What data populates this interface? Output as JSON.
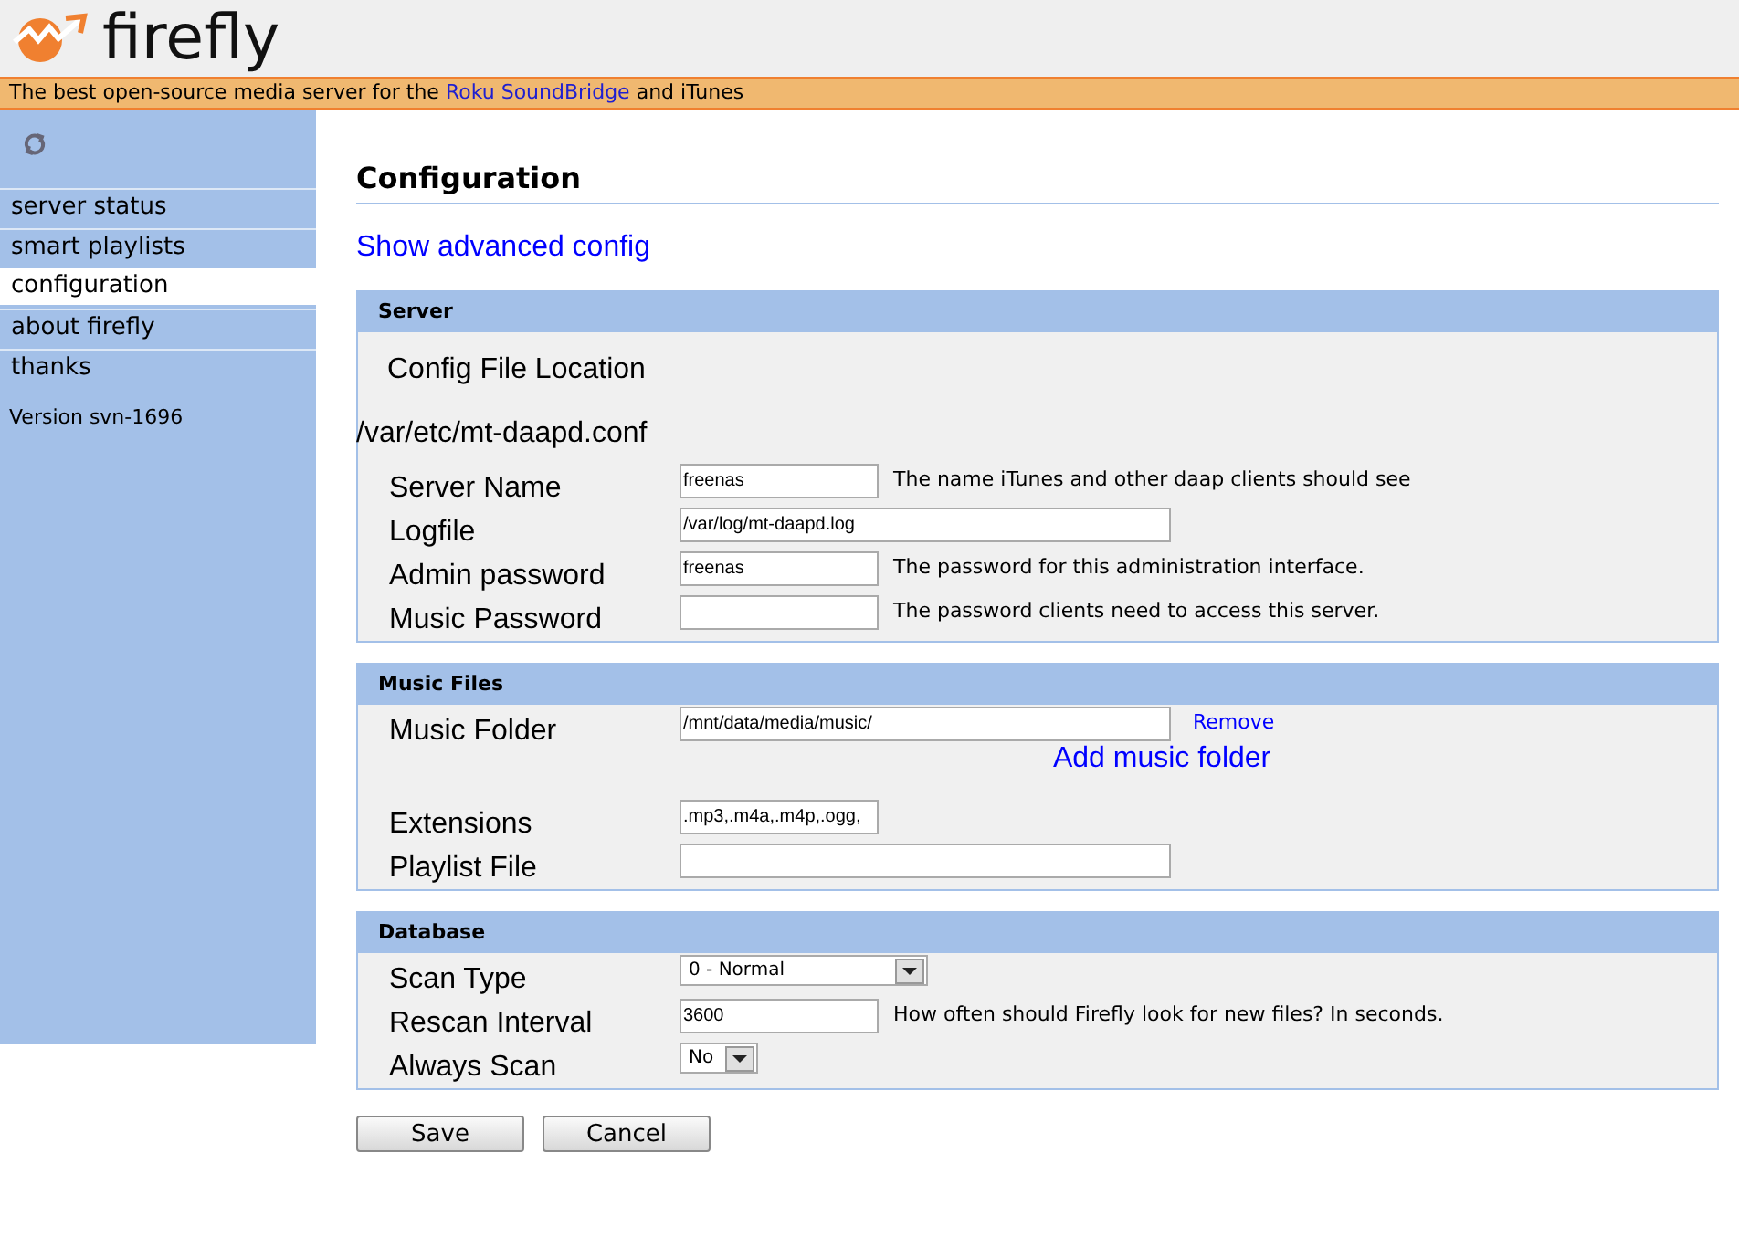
{
  "logo": {
    "text": "firefly"
  },
  "tagline": {
    "before": "The best open-source media server for the",
    "link": "Roku SoundBridge",
    "after": "and iTunes"
  },
  "sidebar": {
    "items": [
      {
        "label": "server status",
        "selected": false
      },
      {
        "label": "smart playlists",
        "selected": false
      },
      {
        "label": "configuration",
        "selected": true
      },
      {
        "label": "about firefly",
        "selected": false
      },
      {
        "label": "thanks",
        "selected": false
      }
    ],
    "version": "Version svn-1696"
  },
  "page_title": "Configuration",
  "advanced_link": "Show advanced config",
  "sections": [
    {
      "title": "Server",
      "config_label": "Config File Location",
      "config_path": "/var/etc/mt-daapd.conf",
      "rows": [
        {
          "kind": "input",
          "label": "Server Name",
          "value": "freenas",
          "hint": "The name iTunes and other daap clients should see"
        },
        {
          "kind": "wide_input",
          "label": "Logfile",
          "value": "/var/log/mt-daapd.log"
        },
        {
          "kind": "input",
          "label": "Admin password",
          "value": "freenas",
          "hint": "The password for this administration interface."
        },
        {
          "kind": "input",
          "label": "Music Password",
          "hint": "The password clients need to access this server."
        }
      ]
    },
    {
      "title": "Music Files",
      "rows": [
        {
          "kind": "folder",
          "label": "Music Folder",
          "value": "/mnt/data/media/music/",
          "remove": "Remove",
          "add": "Add music folder"
        },
        {
          "kind": "input",
          "label": "Extensions",
          "value": ".mp3,.m4a,.m4p,.ogg,"
        },
        {
          "kind": "wide_input",
          "label": "Playlist File"
        }
      ]
    },
    {
      "title": "Database",
      "rows": [
        {
          "kind": "select",
          "label": "Scan Type",
          "value": "0 - Normal"
        },
        {
          "kind": "input",
          "label": "Rescan Interval",
          "value": "3600",
          "hint": "How often should Firefly look for new files? In seconds."
        },
        {
          "kind": "small_select",
          "label": "Always Scan",
          "value": "No"
        }
      ]
    }
  ],
  "buttons": [
    "Save",
    "Cancel"
  ]
}
